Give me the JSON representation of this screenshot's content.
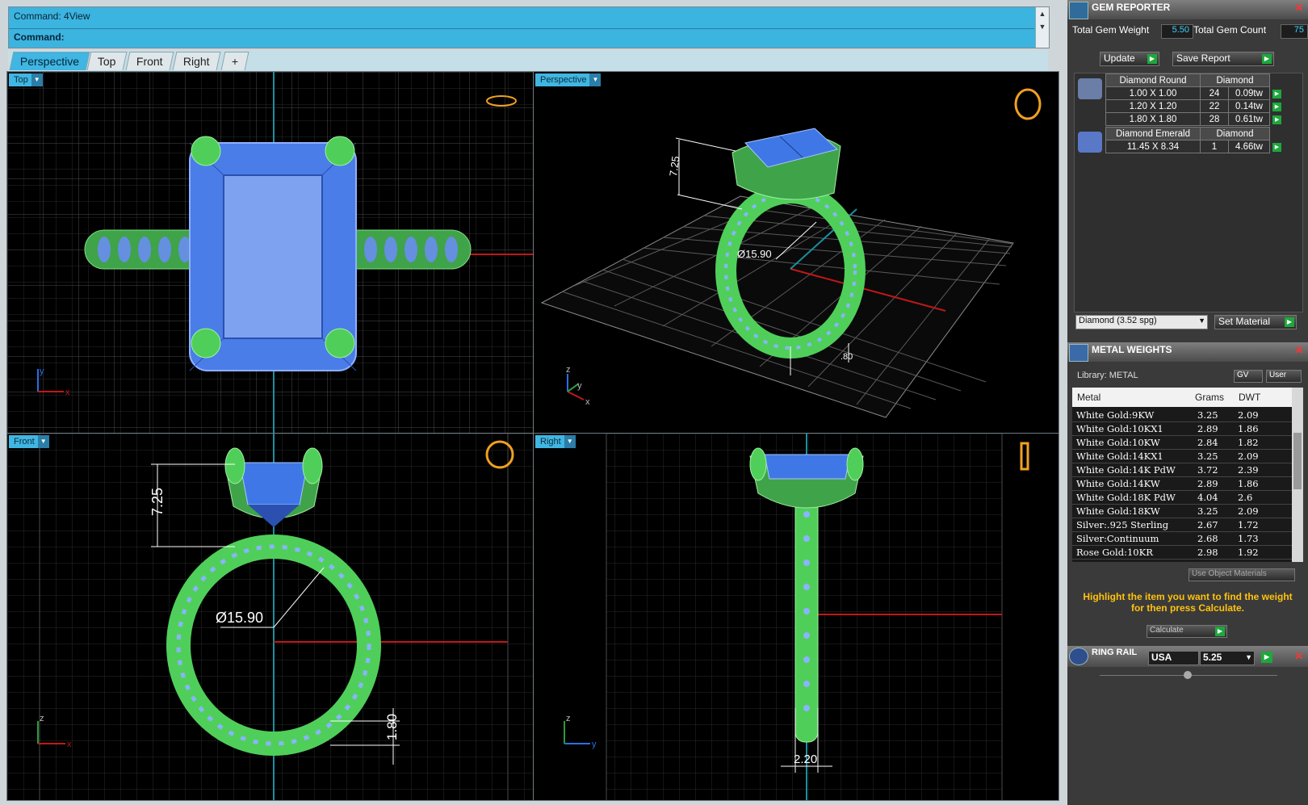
{
  "command": {
    "history": "Command: 4View",
    "prompt": "Command:"
  },
  "tabs": [
    "Perspective",
    "Top",
    "Front",
    "Right",
    "+"
  ],
  "viewports": {
    "top": {
      "label": "Top",
      "axis_a": "y",
      "axis_b": "x"
    },
    "perspective": {
      "label": "Perspective",
      "dim_height": "7.25",
      "dim_diameter": "Ø15.90",
      "dim_band": ".80",
      "axis_a": "z",
      "axis_b": "y",
      "axis_c": "x"
    },
    "front": {
      "label": "Front",
      "dim_height": "7.25",
      "dim_diameter": "Ø15.90",
      "dim_band": "1.80",
      "axis_a": "z",
      "axis_b": "x"
    },
    "right": {
      "label": "Right",
      "dim_width": "2.20",
      "axis_a": "z",
      "axis_b": "y"
    }
  },
  "gem_reporter": {
    "title": "GEM REPORTER",
    "total_weight_label": "Total Gem Weight",
    "total_weight": "5.50",
    "total_count_label": "Total Gem Count",
    "total_count": "75",
    "update": "Update",
    "save_report": "Save Report",
    "groups": [
      {
        "name": "Diamond Round",
        "material": "Diamond",
        "rows": [
          {
            "size": "1.00 X 1.00",
            "count": "24",
            "weight": "0.09tw"
          },
          {
            "size": "1.20 X 1.20",
            "count": "22",
            "weight": "0.14tw"
          },
          {
            "size": "1.80 X 1.80",
            "count": "28",
            "weight": "0.61tw"
          }
        ]
      },
      {
        "name": "Diamond Emerald",
        "material": "Diamond",
        "rows": [
          {
            "size": "11.45 X 8.34",
            "count": "1",
            "weight": "4.66tw"
          }
        ]
      }
    ],
    "material_select": "Diamond    (3.52 spg)",
    "set_material": "Set Material"
  },
  "metal_weights": {
    "title": "METAL WEIGHTS",
    "library": "Library: METAL",
    "gv": "GV",
    "user": "User",
    "columns": [
      "Metal",
      "Grams",
      "DWT"
    ],
    "rows": [
      [
        "White Gold:9KW",
        "3.25",
        "2.09"
      ],
      [
        "White Gold:10KX1",
        "2.89",
        "1.86"
      ],
      [
        "White Gold:10KW",
        "2.84",
        "1.82"
      ],
      [
        "White Gold:14KX1",
        "3.25",
        "2.09"
      ],
      [
        "White Gold:14K PdW",
        "3.72",
        "2.39"
      ],
      [
        "White Gold:14KW",
        "2.89",
        "1.86"
      ],
      [
        "White Gold:18K PdW",
        "4.04",
        "2.6"
      ],
      [
        "White Gold:18KW",
        "3.25",
        "2.09"
      ],
      [
        "Silver:.925 Sterling",
        "2.67",
        "1.72"
      ],
      [
        "Silver:Continuum",
        "2.68",
        "1.73"
      ],
      [
        "Rose Gold:10KR",
        "2.98",
        "1.92"
      ]
    ],
    "use_object_materials": "Use Object Materials",
    "hint": "Highlight the item you want to find the weight for then press Calculate.",
    "calculate": "Calculate"
  },
  "ring_rail": {
    "title": "RING RAIL",
    "country": "USA",
    "size": "5.25"
  },
  "colors": {
    "accent": "#3fb6e3",
    "ring": "#4fd35a",
    "gem": "#3f78e6",
    "hint": "#ffc20e"
  }
}
